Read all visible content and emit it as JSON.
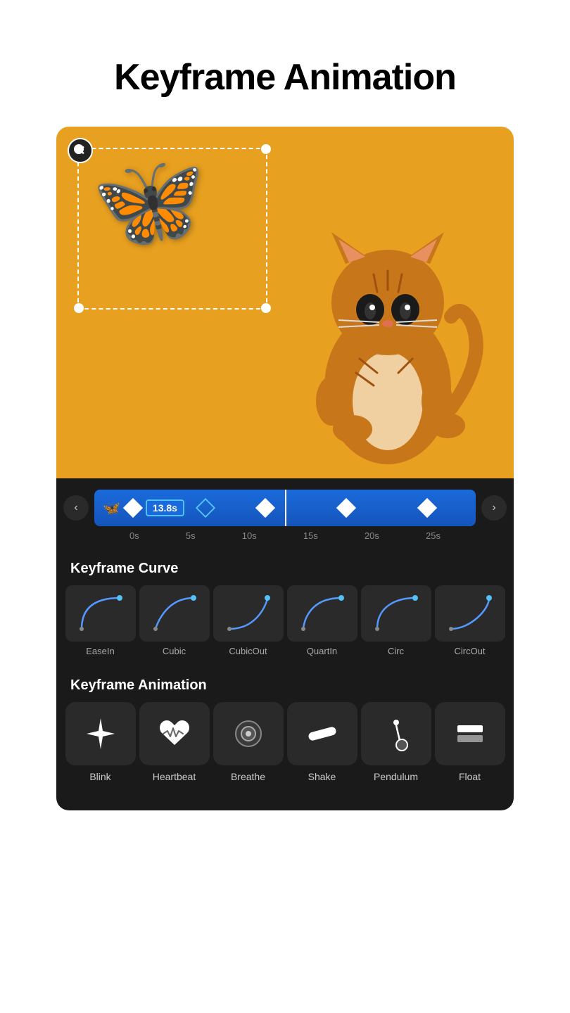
{
  "page": {
    "title": "Keyframe Animation"
  },
  "timeline": {
    "left_arrow": "‹",
    "right_arrow": "›",
    "track_icon": "🦋",
    "time_badge": "13.8s",
    "ruler": [
      "0s",
      "5s",
      "10s",
      "15s",
      "20s",
      "25s"
    ]
  },
  "keyframe_curve": {
    "section_label": "Keyframe Curve",
    "items": [
      {
        "label": "EaseIn",
        "type": "ease-in"
      },
      {
        "label": "Cubic",
        "type": "cubic"
      },
      {
        "label": "CubicOut",
        "type": "cubic-out"
      },
      {
        "label": "QuartIn",
        "type": "quart-in"
      },
      {
        "label": "Circ",
        "type": "circ"
      },
      {
        "label": "CircOut",
        "type": "circ-out"
      }
    ]
  },
  "keyframe_animation": {
    "section_label": "Keyframe Animation",
    "items": [
      {
        "label": "Blink",
        "icon": "blink"
      },
      {
        "label": "Heartbeat",
        "icon": "heartbeat"
      },
      {
        "label": "Breathe",
        "icon": "breathe"
      },
      {
        "label": "Shake",
        "icon": "shake"
      },
      {
        "label": "Pendulum",
        "icon": "pendulum"
      },
      {
        "label": "Float",
        "icon": "float"
      }
    ]
  },
  "colors": {
    "accent_blue": "#1a6adb",
    "background_dark": "#1a1a1a",
    "panel_dark": "#2a2a2a",
    "canvas_bg": "#e8a020",
    "text_primary": "#ffffff",
    "text_secondary": "#aaaaaa"
  }
}
